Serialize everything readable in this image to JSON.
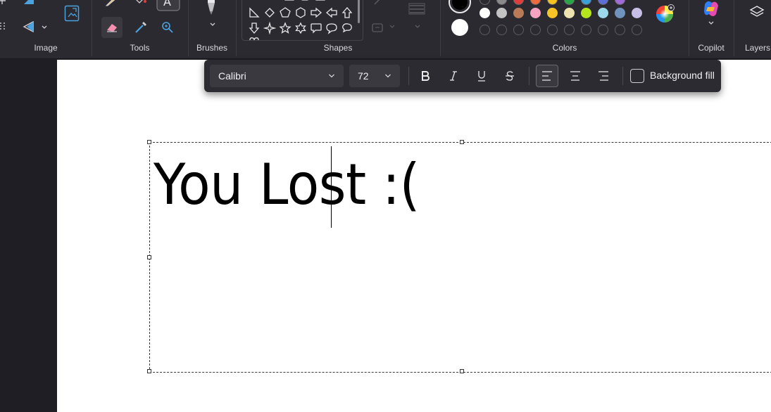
{
  "ribbon": {
    "groups": {
      "image": "Image",
      "tools": "Tools",
      "brushes": "Brushes",
      "shapes": "Shapes",
      "colors": "Colors",
      "copilot": "Copilot",
      "layers": "Layers"
    }
  },
  "colors": {
    "primary": "#000000",
    "secondary": "#ffffff",
    "row_top": [
      "#2b2a30",
      "#8a8a8a",
      "#e03c3c",
      "#f06b3c",
      "#f6c21c",
      "#28a745",
      "#3aa0d8",
      "#5a6fd8",
      "#a06ad8"
    ],
    "row_middle": [
      "#ffffff",
      "#c3c3c3",
      "#b97a57",
      "#f5a3c1",
      "#f7c325",
      "#eee3b0",
      "#b5e61d",
      "#99d9ea",
      "#7092be",
      "#c8bfe7"
    ],
    "row_empty_count": 10
  },
  "text_toolbar": {
    "font_family": "Calibri",
    "font_size": "72",
    "bold": false,
    "italic": false,
    "underline": false,
    "strikethrough": false,
    "alignment": "left",
    "background_fill_label": "Background fill",
    "background_fill_checked": false
  },
  "canvas": {
    "text": "You Lost :("
  }
}
